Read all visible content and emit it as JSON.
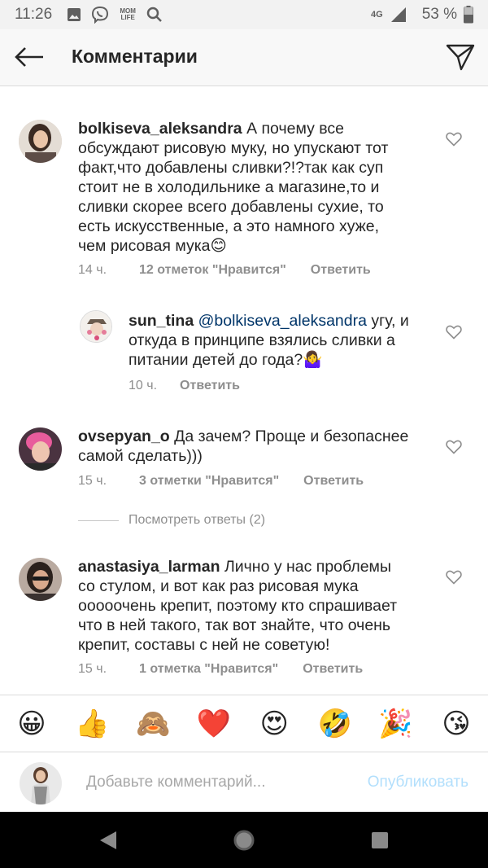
{
  "status_bar": {
    "time": "11:26",
    "mom_life_label": "MOM LIFE",
    "network": "4G",
    "battery": "53 %"
  },
  "header": {
    "title": "Комментарии"
  },
  "comments": [
    {
      "username": "bolkiseva_aleksandra",
      "text": "А почему все обсуждают рисовую муку, но упускают тот факт,что добавлены сливки?!?так как суп стоит не в холодильнике а магазине,то и сливки скорее всего добавлены сухие, то есть искусственные, а это намного хуже, чем рисовая мука😊",
      "lines": [
        "А почему все",
        "обсуждают рисовую муку, но упускают тот",
        "факт,что добавлены сливки?!?так как суп",
        "стоит не в холодильнике а магазине,то и",
        "сливки скорее всего добавлены сухие, то",
        "есть искусственные, а это намного хуже,",
        "чем рисовая мука😊"
      ],
      "time": "14 ч.",
      "likes": "12 отметок \"Нравится\"",
      "reply": "Ответить"
    },
    {
      "username": "sun_tina",
      "mention": "@bolkiseva_aleksandra",
      "lines": [
        "угу, и",
        "откуда в принципе взялись сливки а",
        "питании детей до года?🤷‍♀️"
      ],
      "time": "10 ч.",
      "reply": "Ответить"
    },
    {
      "username": "ovsepyan_o",
      "lines": [
        "Да зачем? Проще и безопаснее",
        "самой сделать)))"
      ],
      "time": "15 ч.",
      "likes": "3 отметки \"Нравится\"",
      "reply": "Ответить"
    },
    {
      "username": "anastasiya_larman",
      "lines": [
        "Лично у нас проблемы",
        "со стулом, и вот как раз рисовая мука",
        "ооооочень крепит, поэтому кто спрашивает",
        "что в ней такого, так вот знайте, что очень",
        "крепит, составы с ней не советую!"
      ],
      "time": "15 ч.",
      "likes": "1 отметка \"Нравится\"",
      "reply": "Ответить"
    }
  ],
  "view_replies": "Посмотреть ответы (2)",
  "emoji_bar": [
    "😀",
    "👍",
    "🙈",
    "❤️",
    "😍",
    "🤣",
    "🎉",
    "😘"
  ],
  "input": {
    "placeholder": "Добавьте комментарий...",
    "publish": "Опубликовать"
  },
  "colors": {
    "link_blue": "#003569",
    "publish_disabled": "#b2dffc",
    "meta_gray": "#8e8e8e"
  }
}
